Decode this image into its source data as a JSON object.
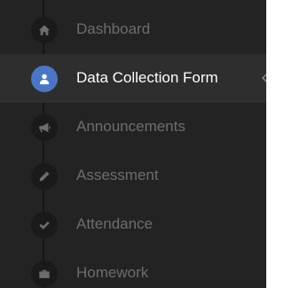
{
  "colors": {
    "background": "#232323",
    "active_background": "#2e2e2e",
    "active_accent": "#4a76c7",
    "text": "#6d6d6d",
    "active_text": "#ffffff"
  },
  "sidebar": {
    "items": [
      {
        "label": "Dashboard",
        "icon": "home-icon",
        "active": false
      },
      {
        "label": "Data Collection Form",
        "icon": "user-icon",
        "active": true
      },
      {
        "label": "Announcements",
        "icon": "megaphone-icon",
        "active": false
      },
      {
        "label": "Assessment",
        "icon": "pencil-icon",
        "active": false
      },
      {
        "label": "Attendance",
        "icon": "check-icon",
        "active": false
      },
      {
        "label": "Homework",
        "icon": "briefcase-icon",
        "active": false
      }
    ]
  }
}
